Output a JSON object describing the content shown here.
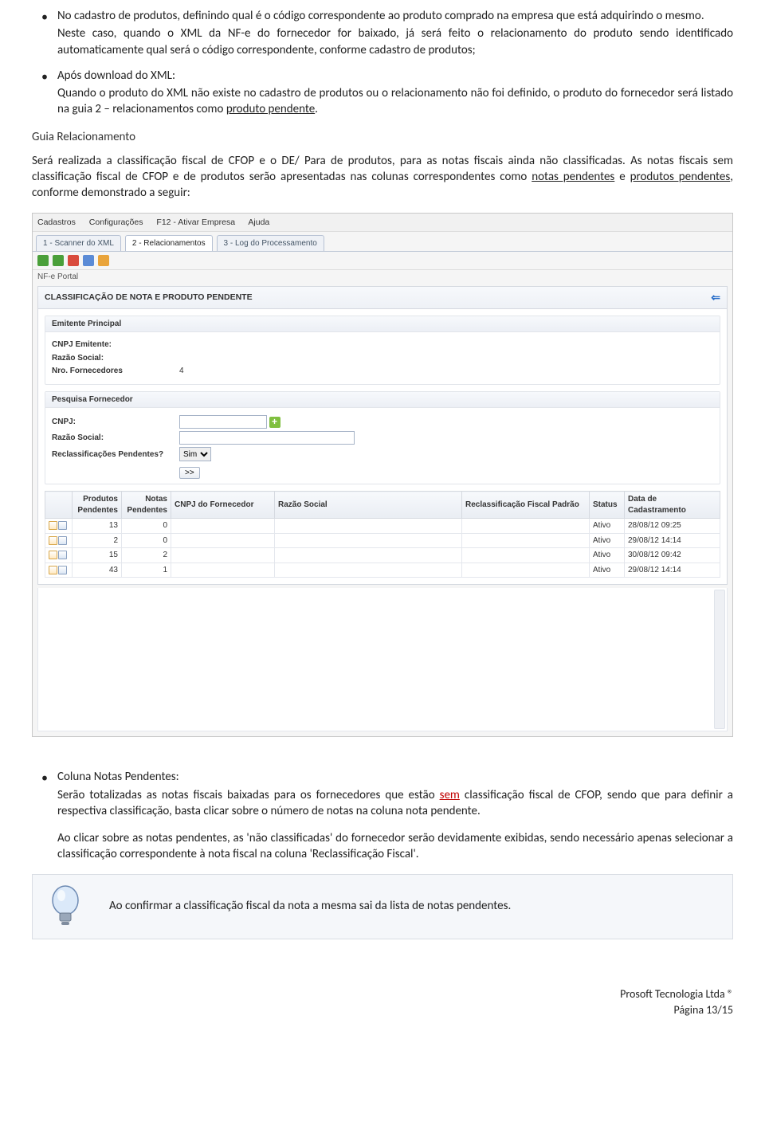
{
  "bullets_top": [
    {
      "intro": "No cadastro de produtos, definindo qual é o código correspondente ao produto comprado na empresa que está adquirindo o mesmo.",
      "body": "Neste caso, quando o XML da NF-e do fornecedor for baixado, já será feito o relacionamento do produto sendo identificado automaticamente qual será o código correspondente, conforme cadastro de produtos;"
    },
    {
      "intro": "Após download do XML:",
      "body_pre": "Quando o produto do XML não existe no cadastro de produtos ou o relacionamento não foi definido, o produto do fornecedor será listado na guia 2 – relacionamentos como ",
      "body_u": "produto pendente",
      "body_post": "."
    }
  ],
  "guia_heading": "Guia Relacionamento",
  "guia_para_pre": "Será realizada a classificação fiscal de CFOP e o DE/ Para de produtos, para as notas fiscais ainda não classificadas. As notas fiscais sem classificação fiscal de CFOP e de produtos serão apresentadas nas colunas correspondentes como ",
  "guia_para_u1": "notas pendentes",
  "guia_para_mid": " e ",
  "guia_para_u2": "produtos pendentes",
  "guia_para_post": ", conforme demonstrado a seguir:",
  "app": {
    "menu": [
      "Cadastros",
      "Configurações",
      "F12 - Ativar Empresa",
      "Ajuda"
    ],
    "tabs": [
      "1 - Scanner do XML",
      "2 - Relacionamentos",
      "3 - Log do Processamento"
    ],
    "active_tab": 1,
    "portal_label": "NF-e Portal",
    "panel_title": "CLASSIFICAÇÃO DE NOTA E PRODUTO PENDENTE",
    "group1_title": "Emitente Principal",
    "g1_rows": [
      {
        "label": "CNPJ Emitente:",
        "value": ""
      },
      {
        "label": "Razão Social:",
        "value": ""
      },
      {
        "label": "Nro. Fornecedores",
        "value": "4"
      }
    ],
    "group2_title": "Pesquisa Fornecedor",
    "g2": {
      "cnpj_label": "CNPJ:",
      "razao_label": "Razão Social:",
      "reclass_label": "Reclassificações Pendentes?",
      "reclass_value": "Sim",
      "go_label": ">>"
    },
    "cols": [
      "",
      "Produtos Pendentes",
      "Notas Pendentes",
      "CNPJ do Fornecedor",
      "Razão Social",
      "Reclassificação Fiscal Padrão",
      "Status",
      "Data de Cadastramento"
    ],
    "rows": [
      {
        "pp": "13",
        "np": "0",
        "cnpj": "",
        "razao": "",
        "rfp": "",
        "status": "Ativo",
        "data": "28/08/12 09:25"
      },
      {
        "pp": "2",
        "np": "0",
        "cnpj": "",
        "razao": "",
        "rfp": "",
        "status": "Ativo",
        "data": "29/08/12 14:14"
      },
      {
        "pp": "15",
        "np": "2",
        "cnpj": "",
        "razao": "",
        "rfp": "",
        "status": "Ativo",
        "data": "30/08/12 09:42"
      },
      {
        "pp": "43",
        "np": "1",
        "cnpj": "",
        "razao": "",
        "rfp": "",
        "status": "Ativo",
        "data": "29/08/12 14:14"
      }
    ]
  },
  "bullet_bottom": {
    "title": "Coluna Notas Pendentes:",
    "p1_pre": "Serão totalizadas as notas fiscais baixadas para os fornecedores que estão ",
    "p1_red": "sem",
    "p1_post": " classificação fiscal de CFOP, sendo que para definir a respectiva classificação, basta clicar sobre o número de notas na coluna nota pendente.",
    "p2": "Ao clicar sobre as notas pendentes, as 'não classificadas' do fornecedor serão devidamente exibidas, sendo necessário apenas selecionar a classificação correspondente à nota fiscal na coluna 'Reclassificação Fiscal'."
  },
  "tip": "Ao confirmar a classificação fiscal da nota a mesma sai da lista de notas pendentes.",
  "footer": {
    "company": "Prosoft Tecnologia Ltda ®",
    "page": "Página 13/15"
  }
}
